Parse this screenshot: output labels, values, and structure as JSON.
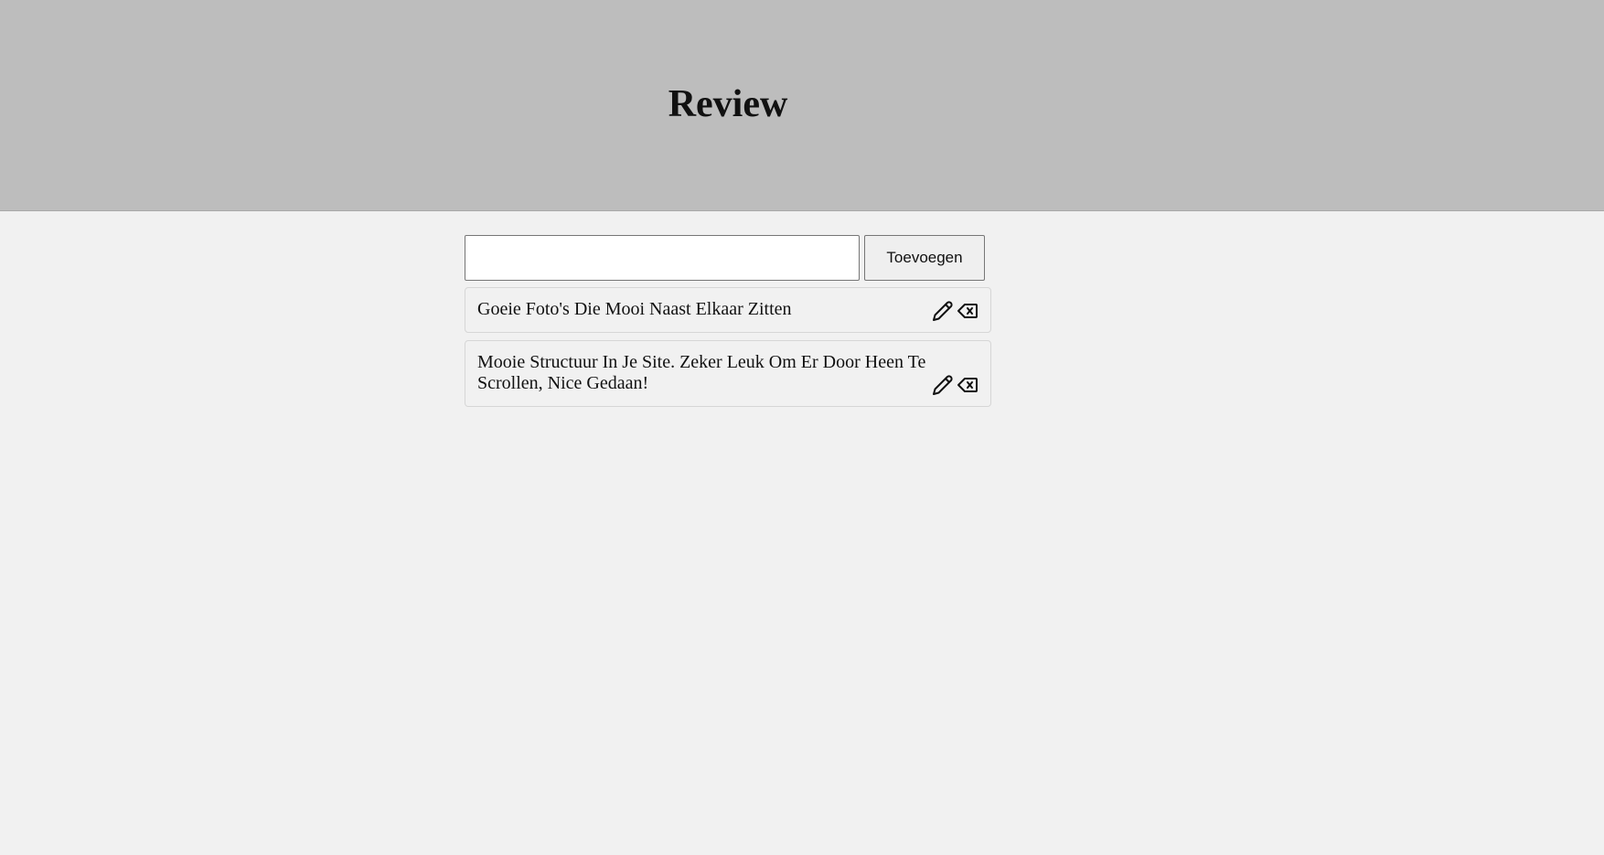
{
  "header": {
    "title": "Review"
  },
  "form": {
    "input_value": "",
    "input_placeholder": "",
    "add_label": "Toevoegen"
  },
  "reviews": [
    {
      "text": "Goeie Foto's Die Mooi Naast Elkaar Zitten",
      "edit_icon": "pencil-icon",
      "delete_icon": "backspace-icon"
    },
    {
      "text": "Mooie Structuur In Je Site. Zeker Leuk Om Er Door Heen Te Scrollen, Nice Gedaan!",
      "edit_icon": "pencil-icon",
      "delete_icon": "backspace-icon"
    }
  ],
  "colors": {
    "header_bg": "#bdbdbd",
    "page_bg": "#f1f1f1",
    "text": "#111111"
  }
}
